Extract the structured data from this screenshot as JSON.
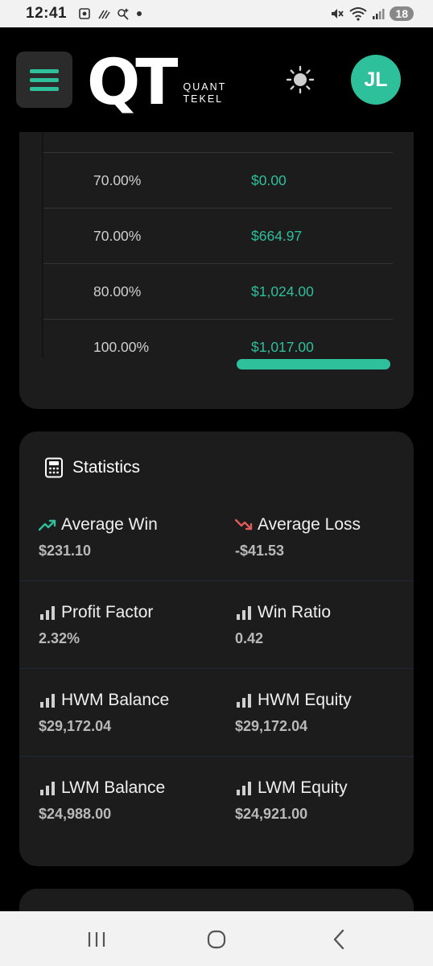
{
  "status_bar": {
    "time": "12:41",
    "battery": "18"
  },
  "header": {
    "logo_mark": "QT",
    "logo_line1": "QUANT",
    "logo_line2": "TEKEL",
    "avatar_initials": "JL"
  },
  "table": {
    "rows": [
      {
        "pct": "70.00%",
        "amount": "$0.00"
      },
      {
        "pct": "70.00%",
        "amount": "$664.97"
      },
      {
        "pct": "80.00%",
        "amount": "$1,024.00"
      },
      {
        "pct": "100.00%",
        "amount": "$1,017.00"
      }
    ]
  },
  "statistics": {
    "title": "Statistics",
    "items": [
      {
        "label": "Average Win",
        "value": "$231.10",
        "icon": "trend-up-icon"
      },
      {
        "label": "Average Loss",
        "value": "-$41.53",
        "icon": "trend-down-icon"
      },
      {
        "label": "Profit Factor",
        "value": "2.32%",
        "icon": "bar-chart-icon"
      },
      {
        "label": "Win Ratio",
        "value": "0.42",
        "icon": "bar-chart-icon"
      },
      {
        "label": "HWM Balance",
        "value": "$29,172.04",
        "icon": "bar-chart-icon"
      },
      {
        "label": "HWM Equity",
        "value": "$29,172.04",
        "icon": "bar-chart-icon"
      },
      {
        "label": "LWM Balance",
        "value": "$24,988.00",
        "icon": "bar-chart-icon"
      },
      {
        "label": "LWM Equity",
        "value": "$24,921.00",
        "icon": "bar-chart-icon"
      }
    ]
  },
  "colors": {
    "accent": "#2ebf9b",
    "loss": "#e05a5a",
    "card": "#1c1c1c",
    "background": "#000000"
  }
}
